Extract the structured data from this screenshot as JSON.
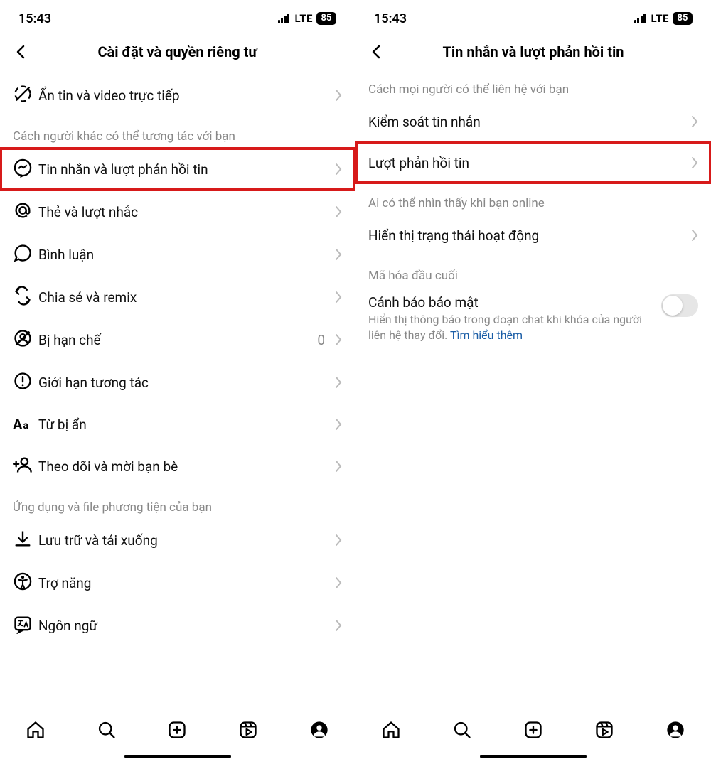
{
  "status": {
    "time": "15:43",
    "net": "LTE",
    "battery": "85"
  },
  "left": {
    "title": "Cài đặt và quyền riêng tư",
    "topRowLabel": "Ẩn tin và video trực tiếp",
    "section1": "Cách người khác có thể tương tác với bạn",
    "rows1": [
      {
        "label": "Tin nhắn và lượt phản hồi tin",
        "highlight": true
      },
      {
        "label": "Thẻ và lượt nhắc"
      },
      {
        "label": "Bình luận"
      },
      {
        "label": "Chia sẻ và remix"
      },
      {
        "label": "Bị hạn chế",
        "trailing": "0"
      },
      {
        "label": "Giới hạn tương tác"
      },
      {
        "label": "Từ bị ẩn"
      },
      {
        "label": "Theo dõi và mời bạn bè"
      }
    ],
    "section2": "Ứng dụng và file phương tiện của bạn",
    "rows2": [
      {
        "label": "Lưu trữ và tải xuống"
      },
      {
        "label": "Trợ năng"
      },
      {
        "label": "Ngôn ngữ"
      }
    ]
  },
  "right": {
    "title": "Tin nhắn và lượt phản hồi tin",
    "section1": "Cách mọi người có thể liên hệ với bạn",
    "rows1": [
      {
        "label": "Kiểm soát tin nhắn"
      },
      {
        "label": "Lượt phản hồi tin",
        "highlight": true
      }
    ],
    "section2": "Ai có thể nhìn thấy khi bạn online",
    "rows2": [
      {
        "label": "Hiển thị trạng thái hoạt động"
      }
    ],
    "section3": "Mã hóa đầu cuối",
    "security": {
      "title": "Cảnh báo bảo mật",
      "desc": "Hiển thị thông báo trong đoạn chat khi khóa của người liên hệ thay đổi. ",
      "link": "Tìm hiểu thêm"
    }
  }
}
